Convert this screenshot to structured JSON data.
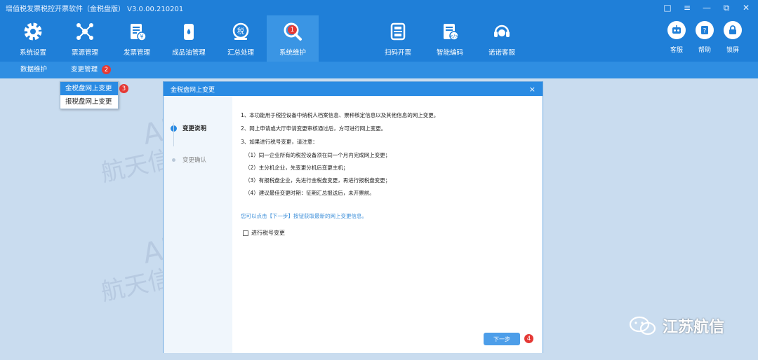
{
  "app": {
    "title": "增值税发票税控开票软件（金税盘版） V3.0.00.210201"
  },
  "window_controls": {
    "message_icon": "□",
    "menu_icon": "≡",
    "minimize": "—",
    "restore": "⧉",
    "close": "✕"
  },
  "toolbar": {
    "items": [
      {
        "label": "系统设置",
        "icon": "gear-icon"
      },
      {
        "label": "票源管理",
        "icon": "network-icon"
      },
      {
        "label": "发票管理",
        "icon": "invoice-icon"
      },
      {
        "label": "成品油管理",
        "icon": "oil-icon"
      },
      {
        "label": "汇总处理",
        "icon": "tax-summary-icon"
      },
      {
        "label": "系统维护",
        "icon": "maintenance-icon",
        "active": true,
        "badge": "1"
      },
      {
        "label": "扫码开票",
        "icon": "scan-icon"
      },
      {
        "label": "智能编码",
        "icon": "smart-code-icon"
      },
      {
        "label": "诺诺客服",
        "icon": "support-icon"
      }
    ],
    "right_items": [
      {
        "label": "客服",
        "icon": "robot-icon"
      },
      {
        "label": "帮助",
        "icon": "help-icon"
      },
      {
        "label": "锁屏",
        "icon": "lock-icon"
      }
    ]
  },
  "subnav": {
    "items": [
      {
        "label": "数据维护"
      },
      {
        "label": "变更管理",
        "badge": "2"
      }
    ]
  },
  "dropdown": {
    "items": [
      {
        "label": "金税盘网上变更",
        "selected": true,
        "badge": "3"
      },
      {
        "label": "报税盘网上变更"
      }
    ]
  },
  "dialog": {
    "title": "金税盘网上变更",
    "close": "×",
    "steps": [
      {
        "label": "变更说明",
        "active": true
      },
      {
        "label": "变更确认",
        "active": false
      }
    ],
    "paragraphs": [
      "1、本功能用于税控设备中纳税人档案信息、票种核定信息以及其他信息的网上变更。",
      "2、网上申请或大厅申请变更审核通过后，方可进行网上变更。",
      "3、如果进行税号变更，请注意：",
      "（1）同一企业所有的税控设备须在同一个月内完成网上变更；",
      "（2）主分机企业，先变更分机后变更主机；",
      "（3）有报税盘企业，先进行金税盘变更，再进行报税盘变更；",
      "（4）建议最佳变更时期：征期汇总报送后，未开票前。"
    ],
    "hint": "您可以点击【下一步】按钮获取最新的网上变更信息。",
    "checkbox_label": "进行税号变更",
    "next_button": "下一步",
    "next_badge": "4"
  },
  "watermark": {
    "lines": [
      "Aisino 航天信息",
      "航天信息江苏有限公司",
      "Aisino 航天信息",
      "航天信息江苏有限公司"
    ]
  },
  "wechat_label": "江苏航信",
  "colors": {
    "brand": "#1f7fd8",
    "badge": "#e53935",
    "selected": "#2a8be3"
  }
}
